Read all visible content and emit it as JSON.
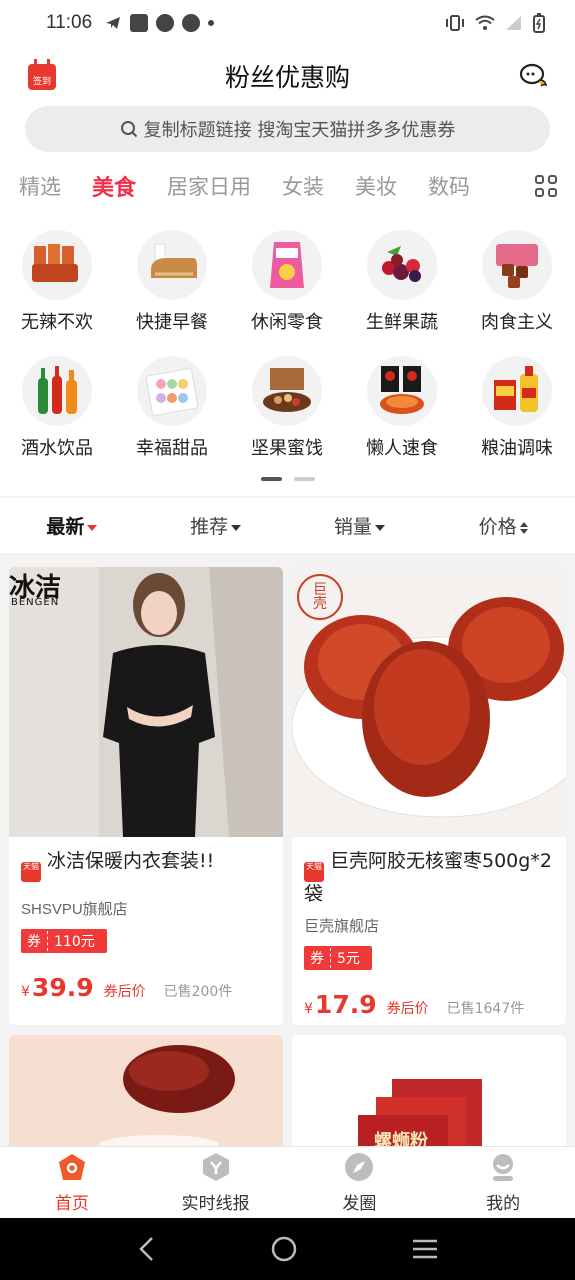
{
  "status_bar": {
    "time": "11:06"
  },
  "header": {
    "title": "粉丝优惠购",
    "checkin_label": "签到"
  },
  "search": {
    "placeholder": "复制标题链接 搜淘宝天猫拼多多优惠券"
  },
  "categories": [
    "精选",
    "美食",
    "居家日用",
    "女装",
    "美妆",
    "数码"
  ],
  "active_category": "美食",
  "subcategories": [
    {
      "label": "无辣不欢",
      "icon": "spicy-snack-icon"
    },
    {
      "label": "快捷早餐",
      "icon": "bread-icon"
    },
    {
      "label": "休闲零食",
      "icon": "chips-icon"
    },
    {
      "label": "生鲜果蔬",
      "icon": "berries-icon"
    },
    {
      "label": "肉食主义",
      "icon": "meat-icon"
    },
    {
      "label": "酒水饮品",
      "icon": "drinks-icon"
    },
    {
      "label": "幸福甜品",
      "icon": "macaron-icon"
    },
    {
      "label": "坚果蜜饯",
      "icon": "nuts-icon"
    },
    {
      "label": "懒人速食",
      "icon": "instant-noodle-icon"
    },
    {
      "label": "粮油调味",
      "icon": "oil-icon"
    }
  ],
  "sort": {
    "latest": "最新",
    "recommend": "推荐",
    "sales": "销量",
    "price": "价格"
  },
  "products": [
    {
      "brand_text": "冰洁",
      "brand_sub": "BENGEN",
      "title": "冰洁保暖内衣套装!!",
      "platform_badge": "天猫",
      "shop": "SHSVPU旗舰店",
      "coupon_label": "券",
      "coupon_value": "110元",
      "currency": "¥",
      "price": "39.9",
      "price_note": "券后价",
      "sold": "已售200件"
    },
    {
      "brand_text": "巨壳",
      "title": "巨壳阿胶无核蜜枣500g*2袋",
      "platform_badge": "天猫",
      "shop": "巨壳旗舰店",
      "coupon_label": "券",
      "coupon_value": "5元",
      "currency": "¥",
      "price": "17.9",
      "price_note": "券后价",
      "sold": "已售1647件"
    },
    {
      "title": ""
    },
    {
      "package_text": "螺蛳粉"
    }
  ],
  "bottom_nav": [
    {
      "label": "首页",
      "icon": "home-icon"
    },
    {
      "label": "实时线报",
      "icon": "news-icon"
    },
    {
      "label": "发圈",
      "icon": "moments-icon"
    },
    {
      "label": "我的",
      "icon": "profile-icon"
    }
  ],
  "colors": {
    "accent": "#e8372c",
    "active_tab": "#f0304a"
  }
}
